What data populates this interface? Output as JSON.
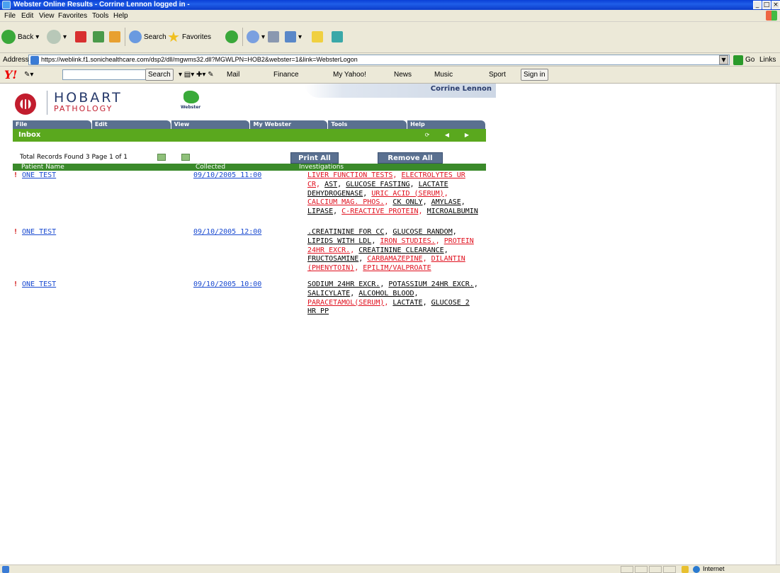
{
  "browser": {
    "title": "Webster Online Results - Corrine Lennon logged in -",
    "menu": [
      "File",
      "Edit",
      "View",
      "Favorites",
      "Tools",
      "Help"
    ],
    "toolbar": {
      "back": "Back",
      "search": "Search",
      "favorites": "Favorites"
    },
    "address_label": "Address",
    "address_url": "https://weblink.f1.sonichealthcare.com/dsp2/dll/mgwms32.dll?MGWLPN=HOB2&webster=1&link=WebsterLogon",
    "go_label": "Go",
    "links_label": "Links",
    "status_zone": "Internet"
  },
  "yahoo": {
    "logo": "Y!",
    "search_button": "Search",
    "items": [
      "Mail",
      "Finance",
      "My Yahoo!",
      "News",
      "Music",
      "Sport"
    ],
    "signin": "Sign in"
  },
  "app": {
    "brand_main": "HOBART",
    "brand_sub": "PATHOLOGY",
    "webster_logo_text": "Webster",
    "user": "Corrine Lennon",
    "nav": [
      "File",
      "Edit",
      "View",
      "My Webster",
      "Tools",
      "Help"
    ],
    "section": "Inbox",
    "records_info": "Total Records Found 3  Page 1 of 1",
    "print_all": "Print All",
    "remove_all": "Remove All",
    "columns": {
      "patient": "Patient Name",
      "collected": "Collected",
      "investigations": "Investigations"
    },
    "accent_green": "#5aa81e",
    "nav_blue": "#5a7090"
  },
  "results": [
    {
      "flag": "!",
      "patient": "ONE TEST",
      "collected": "09/10/2005 11:00",
      "investigations": [
        {
          "text": "LIVER FUNCTION TESTS",
          "abnormal": true
        },
        {
          "text": "ELECTROLYTES UR CR",
          "abnormal": true
        },
        {
          "text": "AST",
          "abnormal": false
        },
        {
          "text": "GLUCOSE FASTING",
          "abnormal": false
        },
        {
          "text": "LACTATE DEHYDROGENASE",
          "abnormal": false
        },
        {
          "text": "URIC ACID (SERUM)",
          "abnormal": true
        },
        {
          "text": "CALCIUM MAG. PHOS.",
          "abnormal": true
        },
        {
          "text": "CK ONLY",
          "abnormal": false
        },
        {
          "text": "AMYLASE",
          "abnormal": false
        },
        {
          "text": "LIPASE",
          "abnormal": false
        },
        {
          "text": "C-REACTIVE PROTEIN",
          "abnormal": true
        },
        {
          "text": "MICROALBUMIN",
          "abnormal": false
        }
      ]
    },
    {
      "flag": "!",
      "patient": "ONE TEST",
      "collected": "09/10/2005 12:00",
      "investigations": [
        {
          "text": ".CREATININE FOR CC",
          "abnormal": false
        },
        {
          "text": "GLUCOSE RANDOM",
          "abnormal": false
        },
        {
          "text": "LIPIDS WITH LDL",
          "abnormal": false
        },
        {
          "text": "IRON STUDIES.",
          "abnormal": true
        },
        {
          "text": "PROTEIN 24HR EXCR.",
          "abnormal": true
        },
        {
          "text": "CREATININE CLEARANCE",
          "abnormal": false
        },
        {
          "text": "FRUCTOSAMINE",
          "abnormal": false
        },
        {
          "text": "CARBAMAZEPINE",
          "abnormal": true
        },
        {
          "text": "DILANTIN (PHENYTOIN)",
          "abnormal": true
        },
        {
          "text": "EPILIM/VALPROATE",
          "abnormal": true
        }
      ]
    },
    {
      "flag": "!",
      "patient": "ONE TEST",
      "collected": "09/10/2005 10:00",
      "investigations": [
        {
          "text": "SODIUM 24HR EXCR.",
          "abnormal": false
        },
        {
          "text": "POTASSIUM 24HR EXCR.",
          "abnormal": false
        },
        {
          "text": "SALICYLATE",
          "abnormal": false
        },
        {
          "text": "ALCOHOL BLOOD",
          "abnormal": false
        },
        {
          "text": "PARACETAMOL(SERUM)",
          "abnormal": true
        },
        {
          "text": "LACTATE",
          "abnormal": false
        },
        {
          "text": "GLUCOSE 2 HR PP",
          "abnormal": false
        }
      ]
    }
  ]
}
